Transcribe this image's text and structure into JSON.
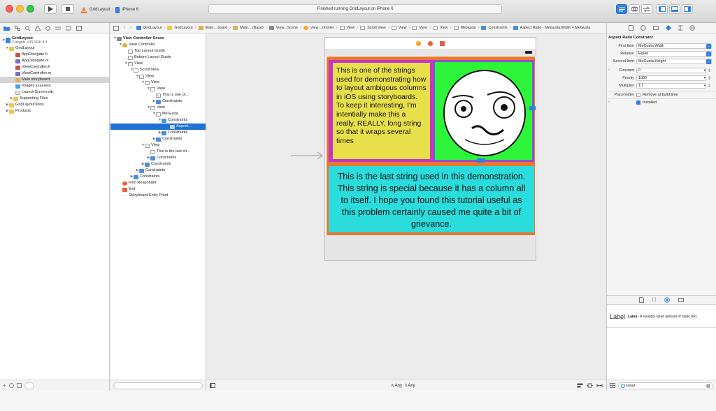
{
  "colors": {
    "accent": "#2f7fe4",
    "selection": "#1f6fd6",
    "canvas": "#ececec",
    "orange": "#e87830",
    "magenta": "#c436c7",
    "yellow": "#e7e04a",
    "green": "#2ef53a",
    "cyan": "#2bdcdc"
  },
  "toolbar": {
    "scheme_target": "GridLayout",
    "scheme_device": "iPhone 6",
    "status": "Finished running GridLayout on iPhone 6"
  },
  "navigator": {
    "project_name": "GridLayout",
    "project_sub": "2 targets, iOS SDK 8.3",
    "items": [
      {
        "label": "GridLayout",
        "kind": "folder"
      },
      {
        "label": "AppDelegate.h",
        "kind": "h"
      },
      {
        "label": "AppDelegate.m",
        "kind": "m"
      },
      {
        "label": "ViewController.h",
        "kind": "h"
      },
      {
        "label": "ViewController.m",
        "kind": "m"
      },
      {
        "label": "Main.storyboard",
        "kind": "storyboard"
      },
      {
        "label": "Images.xcassets",
        "kind": "assets"
      },
      {
        "label": "LaunchScreen.xib",
        "kind": "xib"
      },
      {
        "label": "Supporting Files",
        "kind": "folder"
      },
      {
        "label": "GridLayoutTests",
        "kind": "folder"
      },
      {
        "label": "Products",
        "kind": "folder"
      }
    ]
  },
  "breadcrumbs": [
    "GridLayout",
    "GridLayout",
    "Main....board",
    "Main....(Base)",
    "View...Scene",
    "View....ntroller",
    "View",
    "Scroll View",
    "View",
    "View",
    "View",
    "MeGusta",
    "Constraints",
    "Aspect Ratio - MeGusta.Width = MeGusta"
  ],
  "outline": {
    "items": [
      {
        "label": "View Controller Scene",
        "bold": true
      },
      {
        "label": "View Controller"
      },
      {
        "label": "Top Layout Guide"
      },
      {
        "label": "Bottom Layout Guide"
      },
      {
        "label": "View"
      },
      {
        "label": "Scroll View"
      },
      {
        "label": "View"
      },
      {
        "label": "View"
      },
      {
        "label": "View"
      },
      {
        "label": "This is one of..."
      },
      {
        "label": "Constraints"
      },
      {
        "label": "View"
      },
      {
        "label": "MeGusta"
      },
      {
        "label": "Constraints"
      },
      {
        "label": "Aspect..."
      },
      {
        "label": "Constraints"
      },
      {
        "label": "Constraints"
      },
      {
        "label": "View"
      },
      {
        "label": "This is the last str..."
      },
      {
        "label": "Constraints"
      },
      {
        "label": "Constraints"
      },
      {
        "label": "Constraints"
      },
      {
        "label": "Constraints"
      },
      {
        "label": "First Responder"
      },
      {
        "label": "Exit"
      },
      {
        "label": "Storyboard Entry Point"
      }
    ]
  },
  "canvas": {
    "label1_text": "This is one of the strings used for demonstrating how to layout ambigous columns in iOS using storyboards. To keep it interesting, I'm intentially make this a really, REALLY, long string so that it wraps several times",
    "label2_text": "This is the last string used in this demonstration. This string is special because it has a column all to itself. I hope you found this tutorial useful as this problem certainly caused me quite a bit of grievance.",
    "size_class_w": "w",
    "size_class_w_value": "Any",
    "size_class_h": "h",
    "size_class_h_value": "Any"
  },
  "inspector": {
    "title": "Aspect Ratio Constraint",
    "first_item_label": "First Item",
    "first_item": "MeGusta.Width",
    "relation_label": "Relation",
    "relation": "Equal",
    "second_item_label": "Second Item",
    "second_item": "MeGusta.Height",
    "constant_label": "Constant",
    "constant": "0",
    "priority_label": "Priority",
    "priority": "1000",
    "multiplier_label": "Multiplier",
    "multiplier": "1:1",
    "placeholder_label": "Placeholder",
    "remove_label": "Remove at build time",
    "installed_label": "Installed",
    "library_item_name": "Label",
    "library_item_title": "Label",
    "library_item_desc": "- A variably sized amount of static text.",
    "filter_text": "label"
  }
}
